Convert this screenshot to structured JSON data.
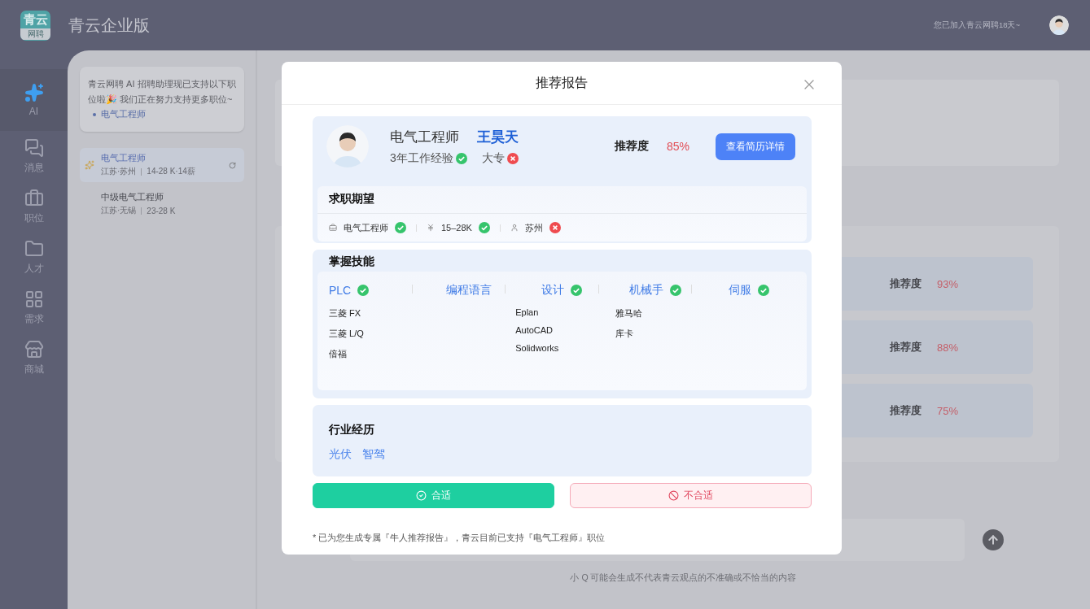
{
  "header": {
    "logo": {
      "main": "青云",
      "sub": "网聘"
    },
    "title": "青云企业版",
    "join_note": "您已加入青云网聘18天~"
  },
  "nav": [
    {
      "kind": "ai",
      "label": "AI",
      "selected": true
    },
    {
      "kind": "message",
      "label": "消息",
      "selected": false
    },
    {
      "kind": "job",
      "label": "职位",
      "selected": false
    },
    {
      "kind": "talent",
      "label": "人才",
      "selected": false
    },
    {
      "kind": "demand",
      "label": "需求",
      "selected": false
    },
    {
      "kind": "store",
      "label": "商城",
      "selected": false
    }
  ],
  "sidebar": {
    "notice": {
      "text": "青云网聘 AI 招聘助理现已支持以下职位啦🎉 我们正在努力支持更多职位~",
      "positions": [
        "电气工程师"
      ]
    },
    "jobs": [
      {
        "title": "电气工程师",
        "location": "江苏·苏州",
        "salary": "14-28 K·14薪",
        "selected": true
      },
      {
        "title": "中级电气工程师",
        "location": "江苏·无锡",
        "salary": "23-28 K",
        "selected": false
      }
    ]
  },
  "chat": {
    "results": [
      {
        "label": "推荐度",
        "score": "93%"
      },
      {
        "label": "推荐度",
        "score": "88%"
      },
      {
        "label": "推荐度",
        "score": "75%"
      }
    ],
    "disclaimer": "小 Q 可能会生成不代表青云观点的不准确或不恰当的内容"
  },
  "modal": {
    "title": "推荐报告",
    "candidate": {
      "position": "电气工程师",
      "name": "王昊天",
      "tags": [
        {
          "label": "3年工作经验",
          "match": true
        },
        {
          "label": "大专",
          "match": false
        }
      ],
      "score_label": "推荐度",
      "score": "85%",
      "detail_button": "查看简历详情"
    },
    "expectation": {
      "title": "求职期望",
      "items": [
        {
          "kind": "job",
          "label": "电气工程师",
          "match": true
        },
        {
          "kind": "salary",
          "label": "15–28K",
          "match": true
        },
        {
          "kind": "location",
          "label": "苏州",
          "match": false
        }
      ]
    },
    "skills": {
      "title": "掌握技能",
      "groups": [
        {
          "name": "PLC",
          "match": true,
          "items": [
            "三菱 FX",
            "三菱 L/Q",
            "倍福"
          ]
        },
        {
          "name": "编程语言"
        },
        {
          "name": "设计",
          "match": true,
          "items": [
            "Eplan",
            "AutoCAD",
            "Solidworks"
          ]
        },
        {
          "name": "机械手",
          "match": true,
          "items": [
            "雅马哈",
            "库卡"
          ]
        },
        {
          "name": "伺服",
          "match": true
        }
      ]
    },
    "industry": {
      "title": "行业经历",
      "tags": [
        "光伏",
        "智驾"
      ]
    },
    "actions": [
      {
        "kind": "accept",
        "label": "合适"
      },
      {
        "kind": "reject",
        "label": "不合适"
      }
    ],
    "footnote": "* 已为您生成专属『牛人推荐报告』，青云目前已支持『电气工程师』职位"
  }
}
